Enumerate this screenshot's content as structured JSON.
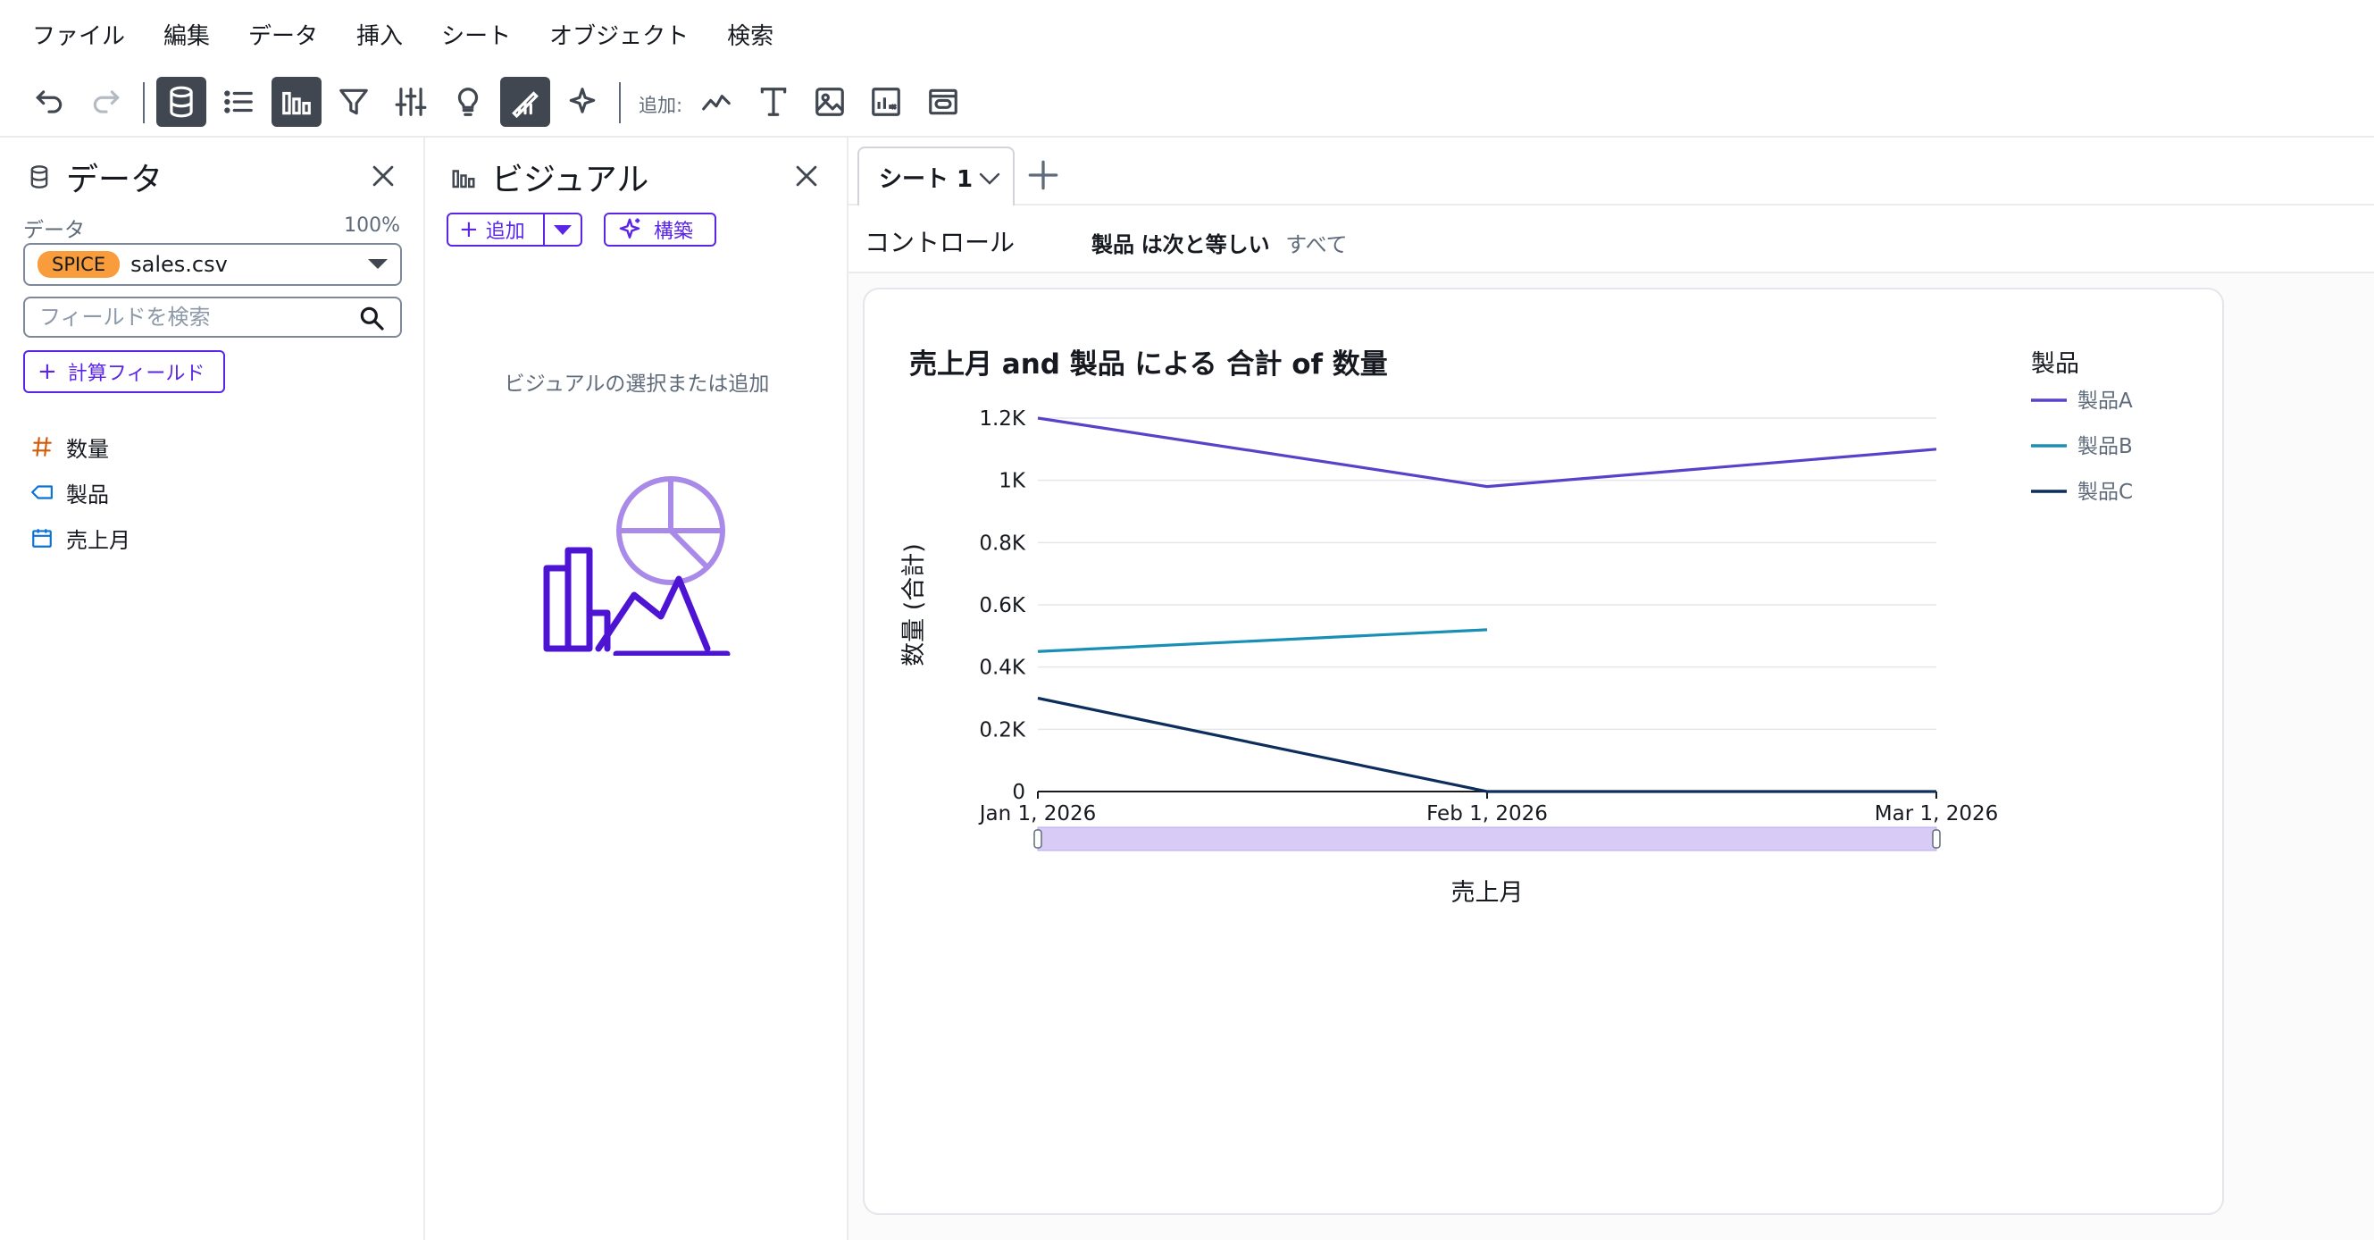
{
  "menu": [
    "ファイル",
    "編集",
    "データ",
    "挿入",
    "シート",
    "オブジェクト",
    "検索"
  ],
  "toolbar": {
    "add_label": "追加:",
    "icons": [
      "undo-icon",
      "redo-icon",
      "database-icon",
      "list-icon",
      "bar-chart-icon",
      "filter-icon",
      "sliders-icon",
      "lightbulb-icon",
      "theme-icon",
      "sparkle-icon",
      "line-chart-icon",
      "text-icon",
      "image-icon",
      "insight-icon",
      "embed-icon"
    ]
  },
  "data_panel": {
    "title": "データ",
    "data_label": "データ",
    "percent": "100%",
    "dataset_badge": "SPICE",
    "dataset_name": "sales.csv",
    "search_placeholder": "フィールドを検索",
    "calc_field_label": "計算フィールド",
    "fields": [
      {
        "name": "数量",
        "type": "number",
        "icon": "hash-icon",
        "color": "#d45b07"
      },
      {
        "name": "製品",
        "type": "string",
        "icon": "tag-icon",
        "color": "#0972d3"
      },
      {
        "name": "売上月",
        "type": "date",
        "icon": "calendar-icon",
        "color": "#0972d3"
      }
    ]
  },
  "visual_panel": {
    "title": "ビジュアル",
    "add_label": "追加",
    "build_label": "構築",
    "empty_hint": "ビジュアルの選択または追加"
  },
  "sheet": {
    "tab_name": "シート 1",
    "controls_label": "コントロール",
    "filter_field": "製品",
    "filter_op": "は次と等しい",
    "filter_value": "すべて"
  },
  "colors": {
    "accent": "#5a25e6",
    "series_a": "#5a41c9",
    "series_b": "#1a8fb5",
    "series_c": "#0d2e5c",
    "zoom_fill": "#d8ccf7"
  },
  "chart_data": {
    "type": "line",
    "title": "売上月 and 製品 による 合計 of 数量",
    "xlabel": "売上月",
    "ylabel": "数量 (合計)",
    "legend_title": "製品",
    "legend_position": "top-right",
    "categories": [
      "Jan 1, 2026",
      "Feb 1, 2026",
      "Mar 1, 2026"
    ],
    "ylim": [
      0,
      1200
    ],
    "y_ticks": [
      0,
      200,
      400,
      600,
      800,
      1000,
      1200
    ],
    "y_tick_labels": [
      "0",
      "0.2K",
      "0.4K",
      "0.6K",
      "0.8K",
      "1K",
      "1.2K"
    ],
    "grid": true,
    "series": [
      {
        "name": "製品A",
        "values": [
          1200,
          980,
          1100
        ]
      },
      {
        "name": "製品B",
        "values": [
          450,
          520,
          null
        ]
      },
      {
        "name": "製品C",
        "values": [
          300,
          0,
          0
        ]
      }
    ]
  }
}
